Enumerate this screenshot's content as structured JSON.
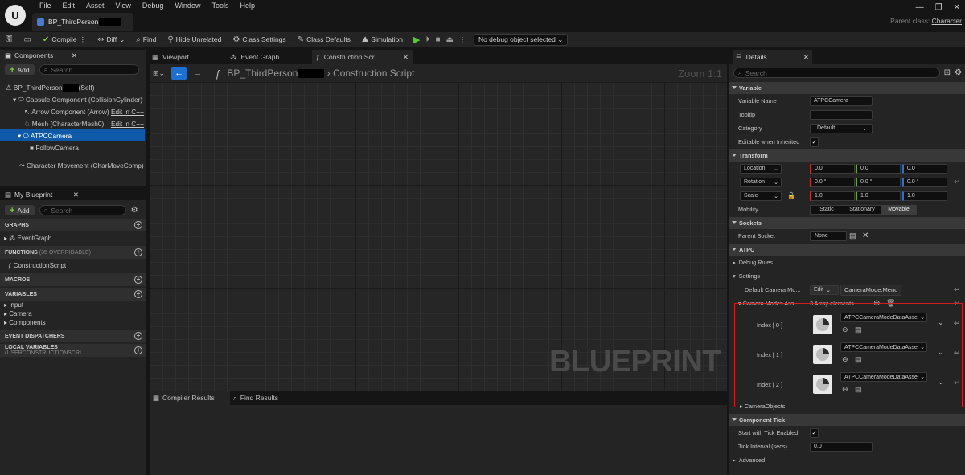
{
  "app": {
    "menu": [
      "File",
      "Edit",
      "Asset",
      "View",
      "Debug",
      "Window",
      "Tools",
      "Help"
    ],
    "doc_tab": "BP_ThirdPerson",
    "parent_label": "Parent class:",
    "parent_value": "Character",
    "window_buttons": [
      "—",
      "❐",
      "✕"
    ]
  },
  "toolbar": {
    "compile": "Compile",
    "diff": "Diff",
    "find": "Find",
    "hide_unrelated": "Hide Unrelated",
    "class_settings": "Class Settings",
    "class_defaults": "Class Defaults",
    "simulation": "Simulation",
    "debug_object": "No debug object selected"
  },
  "components": {
    "title": "Components",
    "add": "Add",
    "search_placeholder": "Search",
    "root_a": "BP_ThirdPerson",
    "root_b": "(Self)",
    "capsule": "Capsule Component (CollisionCylinder)",
    "arrow": "Arrow Component (Arrow)",
    "mesh": "Mesh (CharacterMesh0)",
    "edit_cpp": "Edit in C++",
    "atpc": "ATPCCamera",
    "follow": "FollowCamera",
    "movement": "Character Movement (CharMoveComp)"
  },
  "my_blueprint": {
    "title": "My Blueprint",
    "add": "Add",
    "search_placeholder": "Search",
    "graphs": "GRAPHS",
    "event_graph": "EventGraph",
    "functions": "FUNCTIONS",
    "functions_note": "(35 OVERRIDABLE)",
    "construction": "ConstructionScript",
    "macros": "MACROS",
    "variables": "VARIABLES",
    "var_input": "Input",
    "var_camera": "Camera",
    "var_components": "Components",
    "dispatchers": "EVENT DISPATCHERS",
    "locals": "LOCAL VARIABLES",
    "locals_note": "(USERCONSTRUCTIONSCRI"
  },
  "editor": {
    "tab_viewport": "Viewport",
    "tab_event_graph": "Event Graph",
    "tab_construction": "Construction Scr...",
    "breadcrumb_a": "BP_ThirdPerson",
    "breadcrumb_b": "Construction Script",
    "zoom": "Zoom 1:1",
    "watermark": "BLUEPRINT",
    "tab_compiler": "Compiler Results",
    "tab_find": "Find Results"
  },
  "details": {
    "title": "Details",
    "search_placeholder": "Search",
    "variable": "Variable",
    "variable_name_label": "Variable Name",
    "variable_name": "ATPCCamera",
    "tooltip": "Tooltip",
    "category": "Category",
    "category_value": "Default",
    "editable_inherited": "Editable when Inherited",
    "transform": "Transform",
    "location": "Location",
    "rotation": "Rotation",
    "scale": "Scale",
    "loc": [
      "0.0",
      "0.0",
      "0.0"
    ],
    "rot": [
      "0.0 °",
      "0.0 °",
      "0.0 °"
    ],
    "scl": [
      "1.0",
      "1.0",
      "1.0"
    ],
    "mobility": "Mobility",
    "mobility_opts": [
      "Static",
      "Stationary",
      "Movable"
    ],
    "sockets": "Sockets",
    "parent_socket": "Parent Socket",
    "parent_socket_value": "None",
    "atpc": "ATPC",
    "debug_rules": "Debug Rules",
    "settings": "Settings",
    "default_camera_mode": "Default Camera Mo...",
    "edit": "Edit",
    "default_camera_mode_value": "CameraMode.Menu",
    "camera_modes": "Camera Modes Ass...",
    "array_count": "3 Array elements",
    "items": [
      {
        "index": "Index [ 0 ]",
        "asset": "ATPCCameraModeDataAsse"
      },
      {
        "index": "Index [ 1 ]",
        "asset": "ATPCCameraModeDataAsse"
      },
      {
        "index": "Index [ 2 ]",
        "asset": "ATPCCameraModeDataAsse"
      }
    ],
    "camera_objects": "CameraObjects",
    "component_tick": "Component Tick",
    "start_tick": "Start with Tick Enabled",
    "tick_interval": "Tick Interval (secs)",
    "tick_interval_value": "0.0",
    "advanced": "Advanced"
  }
}
